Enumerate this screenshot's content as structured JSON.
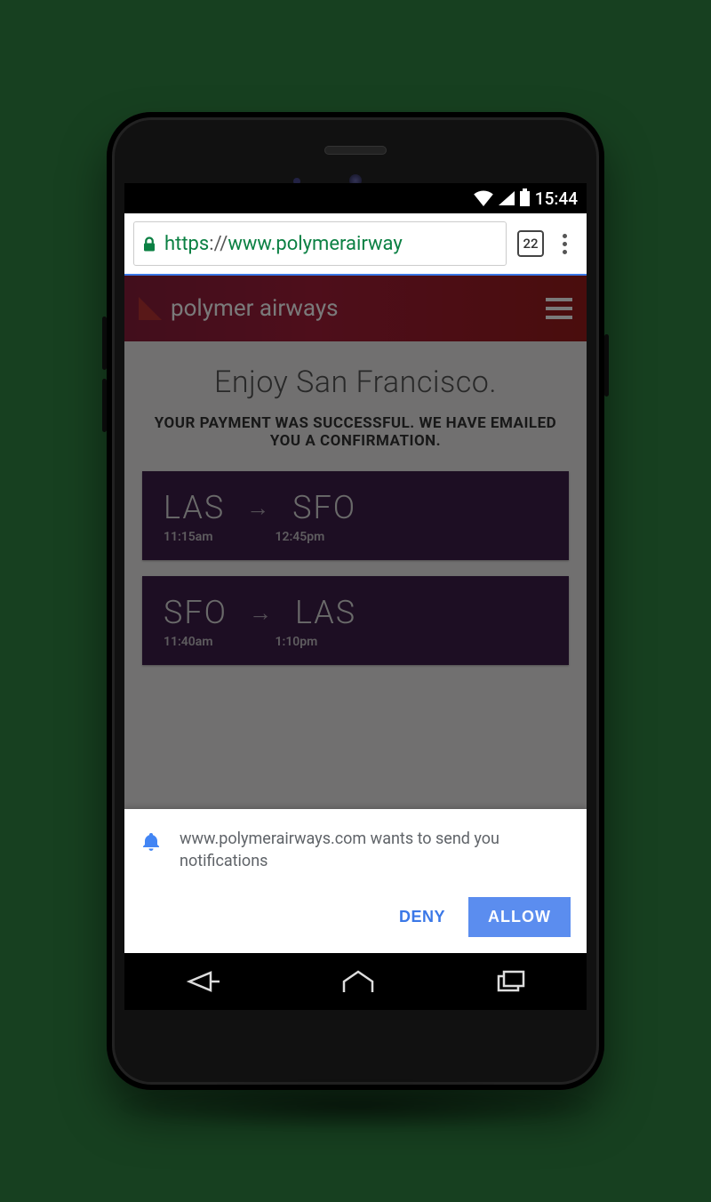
{
  "statusbar": {
    "time": "15:44"
  },
  "omnibox": {
    "scheme": "https",
    "separator": "://",
    "host_visible": "www.polymerairway",
    "tab_count": "22"
  },
  "app": {
    "title": "polymer airways",
    "hero_title": "Enjoy San Francisco.",
    "hero_sub": "YOUR PAYMENT WAS SUCCESSFUL. WE HAVE EMAILED YOU A CONFIRMATION."
  },
  "flights": [
    {
      "from": "LAS",
      "to": "SFO",
      "depart": "11:15am",
      "arrive": "12:45pm"
    },
    {
      "from": "SFO",
      "to": "LAS",
      "depart": "11:40am",
      "arrive": "1:10pm"
    }
  ],
  "prompt": {
    "message": "www.polymerairways.com wants to send you notifications",
    "deny": "DENY",
    "allow": "ALLOW"
  }
}
